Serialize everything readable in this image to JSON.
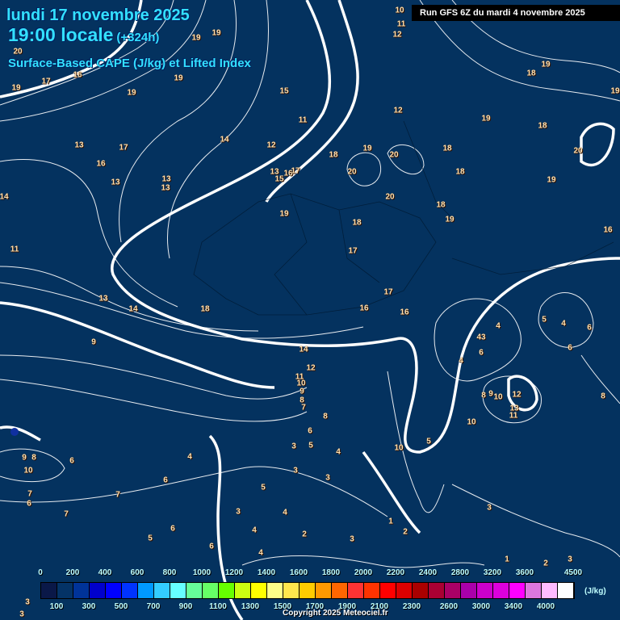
{
  "header": {
    "date": "lundi 17 novembre 2025",
    "time": "19:00 locale",
    "lead": "(+324h)",
    "parameter": "Surface-Based CAPE (J/kg) et Lifted Index",
    "run": "Run GFS 6Z du mardi 4 novembre 2025"
  },
  "contour_labels": [
    "10",
    "11",
    "12",
    "19",
    "19",
    "20",
    "19",
    "19",
    "17",
    "16",
    "19",
    "15",
    "11",
    "12",
    "19",
    "18",
    "19",
    "19",
    "18",
    "13",
    "17",
    "14",
    "12",
    "18",
    "19",
    "20",
    "18",
    "20",
    "16",
    "13",
    "13",
    "13",
    "13",
    "15",
    "16",
    "17",
    "20",
    "18",
    "19",
    "14",
    "20",
    "18",
    "19",
    "19",
    "18",
    "16",
    "11",
    "17",
    "13",
    "17",
    "14",
    "18",
    "16",
    "16",
    "5",
    "4",
    "4",
    "43",
    "6",
    "9",
    "14",
    "4",
    "6",
    "6",
    "12",
    "11",
    "10",
    "9",
    "8",
    "7",
    "8",
    "8",
    "9",
    "10",
    "12",
    "13",
    "11",
    "8",
    "10",
    "6",
    "5",
    "3",
    "10",
    "5",
    "4",
    "8",
    "9",
    "10",
    "6",
    "4",
    "3",
    "3",
    "7",
    "7",
    "6",
    "5",
    "6",
    "7",
    "3",
    "4",
    "3",
    "6",
    "4",
    "1",
    "2",
    "5",
    "2",
    "3",
    "6",
    "4",
    "1",
    "2",
    "3",
    "3",
    "3"
  ],
  "legend": {
    "unit": "(J/kg)",
    "colors": [
      "#0a1848",
      "#043366",
      "#003399",
      "#0000cc",
      "#0000ff",
      "#0033ff",
      "#0099ff",
      "#33ccff",
      "#66ffff",
      "#66ff99",
      "#66ff66",
      "#66ff00",
      "#ccff11",
      "#ffff00",
      "#ffff88",
      "#ffe64d",
      "#ffcc00",
      "#ff9900",
      "#ff6600",
      "#ff3333",
      "#ff3300",
      "#ff0000",
      "#dd0000",
      "#aa0000",
      "#aa0033",
      "#aa0066",
      "#aa00aa",
      "#cc00cc",
      "#dd00dd",
      "#ff00ff",
      "#dd77dd",
      "#ffbbff",
      "#ffffff"
    ],
    "top_ticks": [
      "0",
      "200",
      "400",
      "600",
      "800",
      "1000",
      "1200",
      "1400",
      "1600",
      "1800",
      "2000",
      "2200",
      "2400",
      "2800",
      "3200",
      "3600",
      "4500"
    ],
    "bottom_ticks": [
      "100",
      "300",
      "500",
      "700",
      "900",
      "1100",
      "1300",
      "1500",
      "1700",
      "1900",
      "2100",
      "2300",
      "2600",
      "3000",
      "3400",
      "4000"
    ]
  },
  "copyright": "Copyright 2025 Meteociel.fr"
}
